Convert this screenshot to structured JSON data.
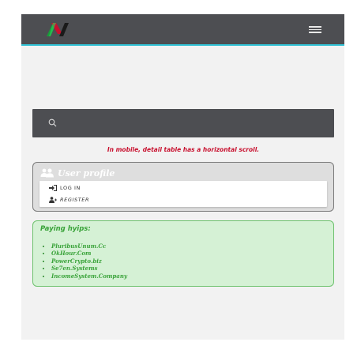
{
  "navbar": {
    "logo_icon": "nv-logo-icon",
    "menu_icon": "hamburger-icon",
    "accent_color": "#32c3d6"
  },
  "search": {
    "icon": "search-icon",
    "placeholder": ""
  },
  "notice": {
    "text": "In mobile, detail table has a horizontal scroll.",
    "color": "#c8102e"
  },
  "user_profile": {
    "title": "User profile",
    "icon": "users-icon",
    "items": [
      {
        "label": "LOG IN",
        "icon": "sign-in-icon"
      },
      {
        "label": "REGISTER",
        "icon": "user-plus-icon"
      }
    ]
  },
  "paying": {
    "title": "Paying hyips:",
    "color": "#3aa33a",
    "items": [
      "PluribusUnum.Cc",
      "OkHour.Com",
      "PowerCrypto.biz",
      "Se7en.Systems",
      "IncomeSystem.Company"
    ]
  }
}
